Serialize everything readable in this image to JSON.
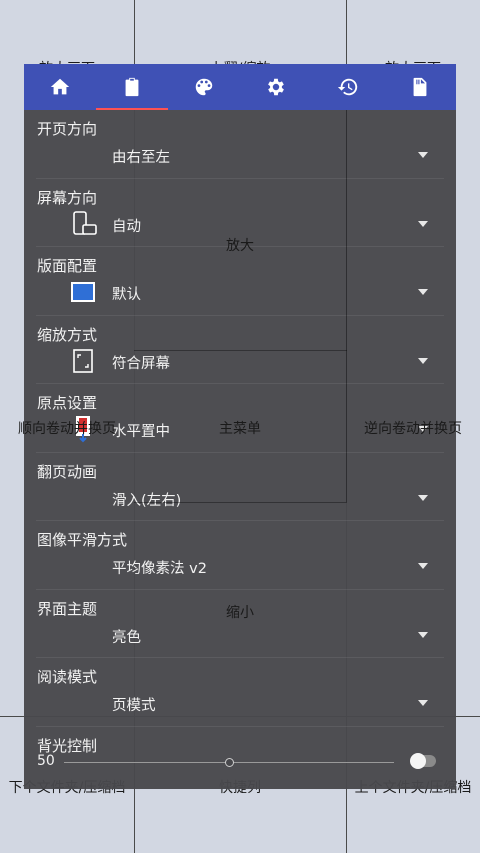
{
  "tabs": [
    {
      "icon": "home-icon",
      "active": false
    },
    {
      "icon": "clipboard-icon",
      "active": true
    },
    {
      "icon": "palette-icon",
      "active": false
    },
    {
      "icon": "gear-icon",
      "active": false
    },
    {
      "icon": "history-icon",
      "active": false
    },
    {
      "icon": "file-icon",
      "active": false
    }
  ],
  "settings": {
    "page_direction": {
      "title": "开页方向",
      "value": "由右至左"
    },
    "screen_orientation": {
      "title": "屏幕方向",
      "value": "自动",
      "icon": "phone-rotate-icon"
    },
    "layout": {
      "title": "版面配置",
      "value": "默认",
      "icon": "single-page-icon"
    },
    "zoom_mode": {
      "title": "缩放方式",
      "value": "符合屏幕",
      "icon": "fit-screen-icon"
    },
    "origin": {
      "title": "原点设置",
      "value": "水平置中",
      "icon": "origin-icon"
    },
    "page_animation": {
      "title": "翻页动画",
      "value": "滑入(左右)"
    },
    "image_smoothing": {
      "title": "图像平滑方式",
      "value": "平均像素法 v2"
    },
    "theme": {
      "title": "界面主题",
      "value": "亮色"
    },
    "reading_mode": {
      "title": "阅读模式",
      "value": "页模式"
    },
    "backlight": {
      "title": "背光控制",
      "value": "50",
      "slider_fraction": 0.5,
      "toggle_on": false
    }
  },
  "zones": {
    "top_left": "放大画面",
    "top_center": "上翻/缩放",
    "top_right": "放大画面",
    "zoom_in": "放大",
    "prev_scroll": "顺向卷动并换页",
    "main_menu": "主菜单",
    "next_scroll": "逆向卷动并换页",
    "zoom_out": "缩小",
    "next_folder": "下个文件夹/压缩档",
    "quick_list": "快捷列",
    "prev_folder": "上个文件夹/压缩档"
  }
}
